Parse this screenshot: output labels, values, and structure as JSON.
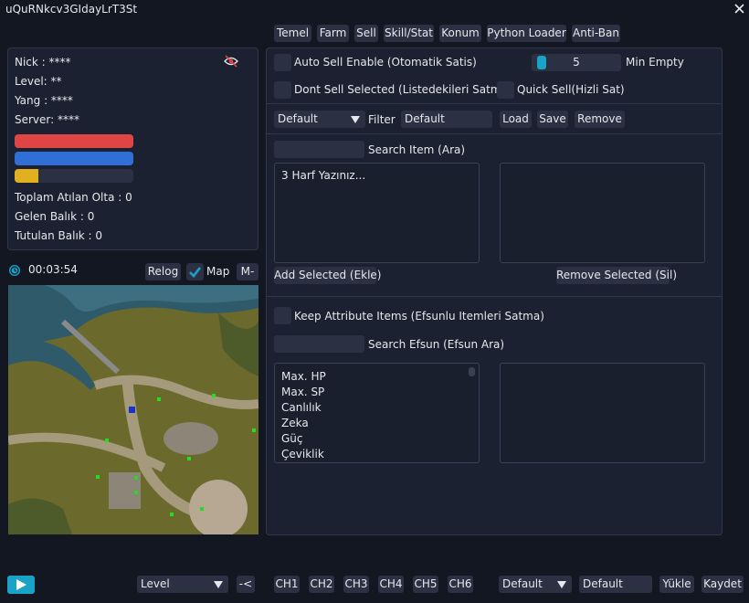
{
  "window": {
    "title": "uQuRNkcv3GIdayLrT3St"
  },
  "tabs": [
    "Temel",
    "Farm",
    "Sell",
    "Skill/Stat",
    "Konum",
    "Python Loader",
    "Anti-Ban"
  ],
  "info": {
    "nick": "Nick : ****",
    "level": "Level: **",
    "yang": "Yang : ****",
    "server": "Server: ****",
    "bars": {
      "red_fill": 1.0,
      "blue_fill": 1.0,
      "yellow_fill": 0.2
    },
    "bar_colors": {
      "red": "#e04545",
      "blue": "#2f6fd6",
      "yellow": "#e0b020",
      "track": "#2b3142"
    },
    "stats": [
      "Toplam Atılan Olta : 0",
      "Gelen Balık : 0",
      "Tutulan Balık : 0"
    ]
  },
  "timer": {
    "value": "00:03:54",
    "relog_label": "Relog",
    "map_label": "Map",
    "map_checked": true,
    "minus_label": "M-"
  },
  "sell": {
    "auto_sell_label": "Auto Sell Enable (Otomatik Satis)",
    "min_empty_value": "5",
    "min_empty_label": "Min Empty",
    "dont_sell_label": "Dont Sell Selected (Listedekileri Satma)",
    "quick_sell_label": "Quick Sell(Hizli Sat)",
    "profile_select": "Default",
    "filter_label": "Filter",
    "filter_value": "Default",
    "load_label": "Load",
    "save_label": "Save",
    "remove_label": "Remove",
    "search_item_label": "Search Item (Ara)",
    "item_list_placeholder": "3 Harf Yazınız...",
    "add_selected_label": "Add Selected (Ekle)",
    "remove_selected_label": "Remove Selected (Sil)",
    "keep_attr_label": "Keep Attribute Items (Efsunlu Itemleri Satma)",
    "search_efsun_label": "Search Efsun (Efsun Ara)",
    "efsun_items": [
      "Max. HP",
      "Max. SP",
      "Canlılık",
      "Zeka",
      "Güç",
      "Çeviklik"
    ]
  },
  "bottom": {
    "level_select": "Level",
    "back_label": "-<",
    "channels": [
      "CH1",
      "CH2",
      "CH3",
      "CH4",
      "CH5",
      "CH6"
    ],
    "profile_select": "Default",
    "profile_name": "Default",
    "load_label": "Yükle",
    "save_label": "Kaydet"
  },
  "colors": {
    "accent": "#1aa3c9",
    "background": "#131722",
    "panel": "#1c2131",
    "control": "#2b3142"
  },
  "icons": {
    "close": "close-icon",
    "hide": "eye-slash-icon",
    "timer": "clock-icon",
    "play": "play-icon",
    "check": "check-icon"
  }
}
